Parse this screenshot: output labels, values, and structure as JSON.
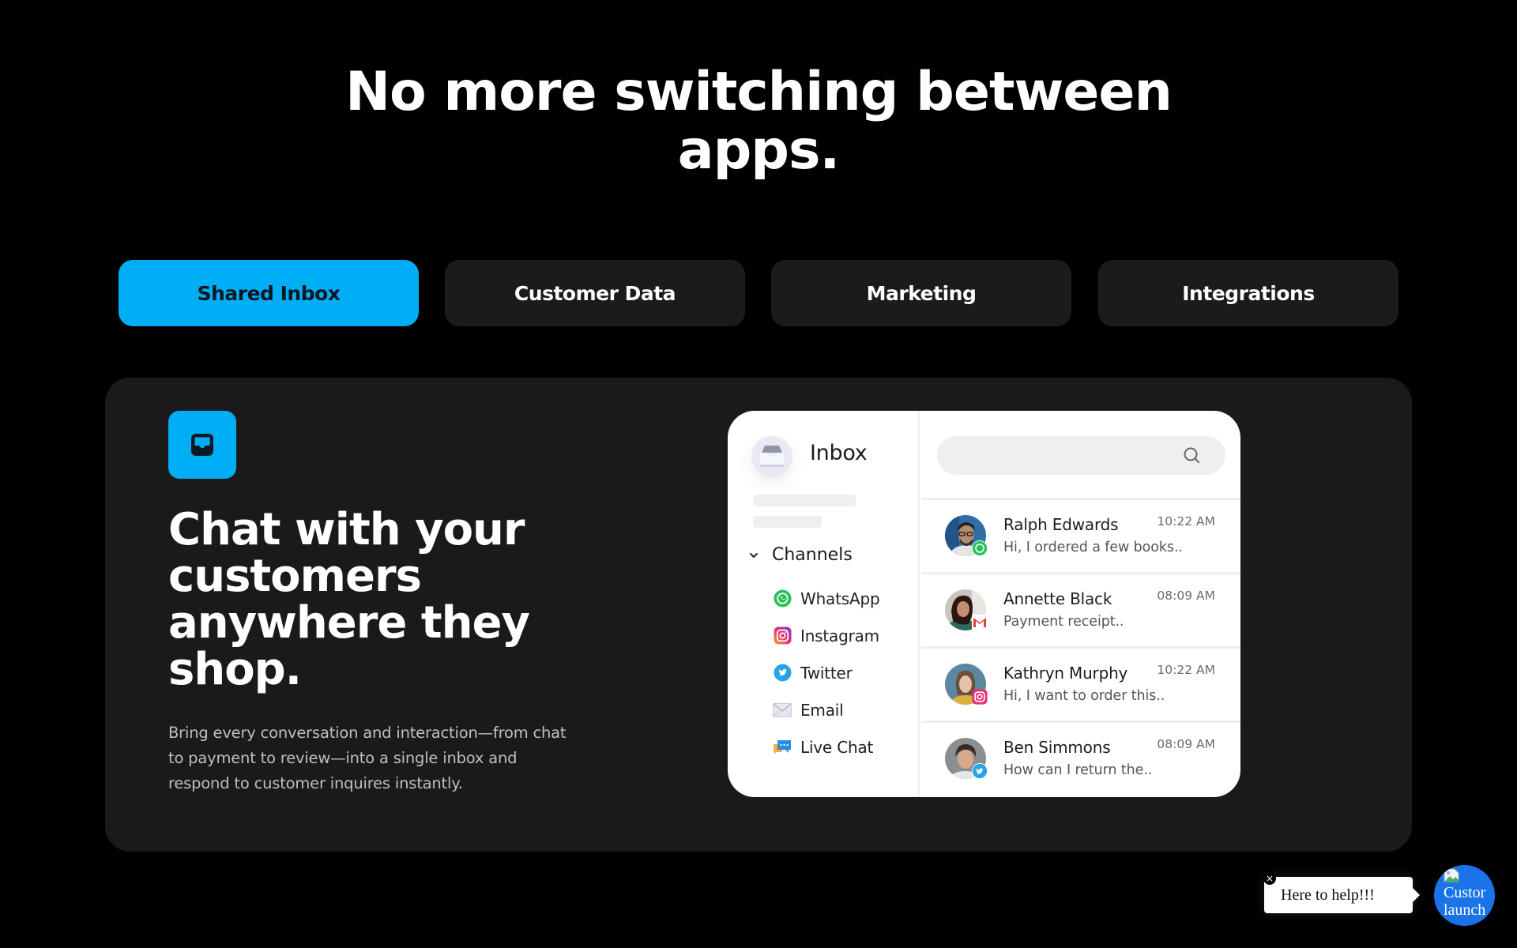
{
  "hero": {
    "title_lines": [
      "No more switching between",
      "apps."
    ]
  },
  "tabs": [
    {
      "label": "Shared Inbox",
      "active": true
    },
    {
      "label": "Customer Data",
      "active": false
    },
    {
      "label": "Marketing",
      "active": false
    },
    {
      "label": "Integrations",
      "active": false
    }
  ],
  "feature": {
    "icon": "inbox-tray-icon",
    "heading_lines": [
      "Chat with your",
      "customers",
      "anywhere they",
      "shop."
    ],
    "description_lines": [
      "Bring every conversation and interaction—from chat",
      "to payment to review—into a single inbox and",
      "respond to customer inquires instantly."
    ]
  },
  "mockup": {
    "sidebar": {
      "title": "Inbox",
      "channels_label": "Channels",
      "channels": [
        {
          "label": "WhatsApp",
          "icon": "whatsapp-icon"
        },
        {
          "label": "Instagram",
          "icon": "instagram-icon"
        },
        {
          "label": "Twitter",
          "icon": "twitter-icon"
        },
        {
          "label": "Email",
          "icon": "email-icon"
        },
        {
          "label": "Live Chat",
          "icon": "live-chat-icon"
        }
      ]
    },
    "search": {
      "placeholder": ""
    },
    "conversations": [
      {
        "name": "Ralph Edwards",
        "time": "10:22 AM",
        "preview": "Hi, I ordered a few books..",
        "channel": "whatsapp"
      },
      {
        "name": "Annette Black",
        "time": "08:09 AM",
        "preview": "Payment receipt..",
        "channel": "gmail"
      },
      {
        "name": "Kathryn Murphy",
        "time": "10:22 AM",
        "preview": "Hi, I want to order this..",
        "channel": "instagram"
      },
      {
        "name": "Ben Simmons",
        "time": "08:09 AM",
        "preview": "How can I return the..",
        "channel": "twitter"
      }
    ]
  },
  "widget": {
    "bubble_text": "Here to help!!!",
    "close_label": "×",
    "launcher_alt_lines": [
      "Custor",
      "launch"
    ]
  },
  "colors": {
    "accent": "#00aef5",
    "background": "#000000",
    "card": "#1a1a1a",
    "launcher": "#1a73e8"
  }
}
